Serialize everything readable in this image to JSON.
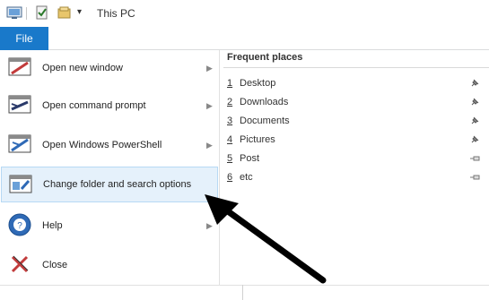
{
  "titlebar": {
    "title": "This PC",
    "icons": [
      "properties-icon",
      "new-folder-icon",
      "qat-dropdown-icon"
    ]
  },
  "ribbon": {
    "file_tab_label": "File"
  },
  "file_menu": {
    "items": [
      {
        "label": "Open new window",
        "icon": "new-window-icon",
        "has_submenu": true
      },
      {
        "label": "Open command prompt",
        "icon": "command-prompt-icon",
        "has_submenu": true
      },
      {
        "label": "Open Windows PowerShell",
        "icon": "powershell-icon",
        "has_submenu": true
      },
      {
        "label": "Change folder and search options",
        "icon": "folder-options-icon",
        "has_submenu": false,
        "selected": true
      },
      {
        "label": "Help",
        "icon": "help-icon",
        "has_submenu": true
      },
      {
        "label": "Close",
        "icon": "close-icon",
        "has_submenu": false
      }
    ]
  },
  "frequent_places": {
    "header": "Frequent places",
    "items": [
      {
        "num": "1",
        "name": "Desktop",
        "pinned": true
      },
      {
        "num": "2",
        "name": "Downloads",
        "pinned": true
      },
      {
        "num": "3",
        "name": "Documents",
        "pinned": true
      },
      {
        "num": "4",
        "name": "Pictures",
        "pinned": true
      },
      {
        "num": "5",
        "name": "Post",
        "pinned": false
      },
      {
        "num": "6",
        "name": "etc",
        "pinned": false
      }
    ]
  },
  "colors": {
    "file_tab": "#1979ca",
    "selected_bg": "#e5f1fb",
    "selected_border": "#b7d9f4"
  }
}
